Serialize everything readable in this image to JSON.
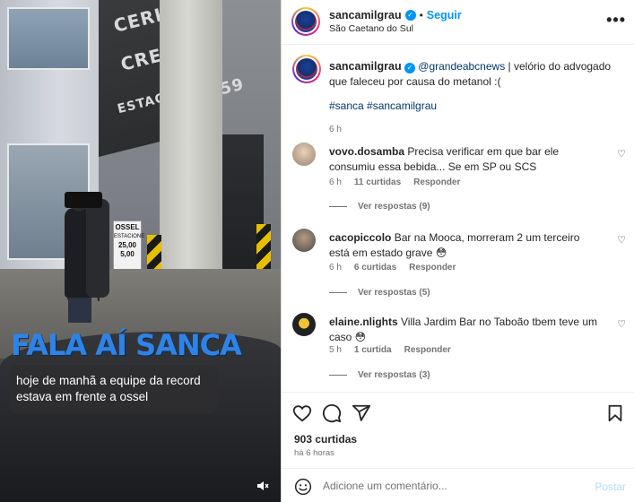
{
  "media": {
    "sign_top": "CERIM",
    "sign_mid": "CREM",
    "sign_bottom": "ESTACION",
    "sign_num": "459",
    "price_label": "OSSEL",
    "price_sign_head": "ESTACIONE",
    "price_1": "25,00",
    "price_2": "5,00",
    "overlay_title": "FALA AÍ SANCA",
    "caption_line1": "hoje de manhã a equipe da record",
    "caption_line2": "estava em frente a ossel",
    "mute_icon": "speaker-muted-icon"
  },
  "header": {
    "username": "sancamilgrau",
    "separator": "•",
    "follow_label": "Seguir",
    "location": "São Caetano do Sul",
    "more_label": "•••"
  },
  "caption": {
    "username": "sancamilgrau",
    "mention": "@grandeabcnews",
    "text": " | velório do advogado que faleceu por causa do metanol :(",
    "hashtags": "#sanca #sancamilgrau",
    "time": "6 h"
  },
  "comments": [
    {
      "username": "vovo.dosamba",
      "text": " Precisa verificar em que bar ele consumiu essa bebida... Se em SP ou SCS",
      "time": "6 h",
      "likes": "11 curtidas",
      "reply": "Responder",
      "view_replies": "Ver respostas (9)"
    },
    {
      "username": "cacopiccolo",
      "text": " Bar na Mooca, morreram 2 um terceiro está em estado grave 😳",
      "time": "6 h",
      "likes": "6 curtidas",
      "reply": "Responder",
      "view_replies": "Ver respostas (5)"
    },
    {
      "username": "elaine.nlights",
      "text": " Villa Jardim Bar no Taboão tbem teve um caso 😳",
      "time": "5 h",
      "likes": "1 curtida",
      "reply": "Responder",
      "view_replies": "Ver respostas (3)"
    }
  ],
  "footer": {
    "likes": "903 curtidas",
    "when": "há 6 horas",
    "comment_placeholder": "Adicione um comentário...",
    "post_label": "Postar"
  },
  "icons": {
    "like": "heart-icon",
    "comment": "comment-icon",
    "share": "share-icon",
    "save": "bookmark-icon",
    "emoji": "emoji-icon"
  },
  "colors": {
    "link_blue": "#0095f6",
    "mention": "#00376b",
    "muted_text": "#737373",
    "overlay_title": "#2f83e6"
  }
}
